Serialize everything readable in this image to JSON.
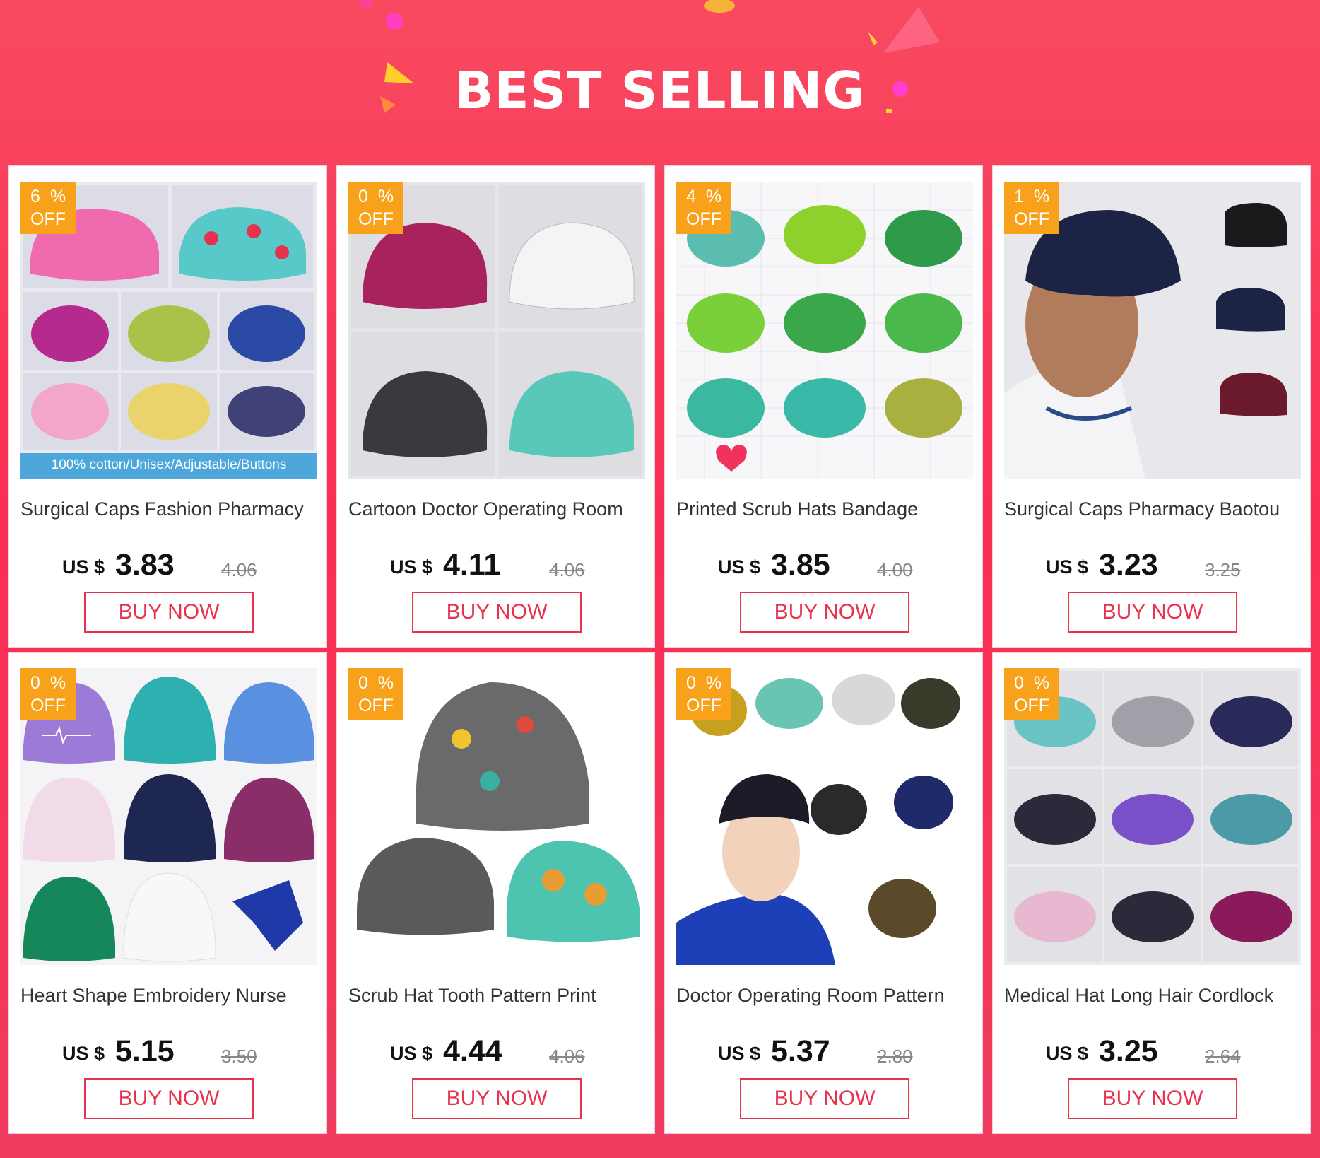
{
  "banner": {
    "title": "BEST SELLING"
  },
  "colors": {
    "background": "#fb2e55",
    "badge": "#f7a21a",
    "button": "#e8334f"
  },
  "products": [
    {
      "discount_digit": "6",
      "discount_symbol": "%",
      "off_label": "OFF",
      "title": "Surgical Caps Fashion Pharmacy",
      "currency": "US $",
      "price": "3.83",
      "original_price": "4.06",
      "button_label": "BUY NOW",
      "image_caption": "100% cotton/Unisex/Adjustable/Buttons"
    },
    {
      "discount_digit": "0",
      "discount_symbol": "%",
      "off_label": "OFF",
      "title": "Cartoon Doctor Operating Room",
      "currency": "US $",
      "price": "4.11",
      "original_price": "4.06",
      "button_label": "BUY NOW"
    },
    {
      "discount_digit": "4",
      "discount_symbol": "%",
      "off_label": "OFF",
      "title": "Printed Scrub Hats Bandage",
      "currency": "US $",
      "price": "3.85",
      "original_price": "4.00",
      "button_label": "BUY NOW"
    },
    {
      "discount_digit": "1",
      "discount_symbol": "%",
      "off_label": "OFF",
      "title": "Surgical Caps Pharmacy Baotou",
      "currency": "US $",
      "price": "3.23",
      "original_price": "3.25",
      "button_label": "BUY NOW"
    },
    {
      "discount_digit": "0",
      "discount_symbol": "%",
      "off_label": "OFF",
      "title": "Heart Shape Embroidery Nurse",
      "currency": "US $",
      "price": "5.15",
      "original_price": "3.50",
      "button_label": "BUY NOW"
    },
    {
      "discount_digit": "0",
      "discount_symbol": "%",
      "off_label": "OFF",
      "title": "Scrub Hat Tooth Pattern Print",
      "currency": "US $",
      "price": "4.44",
      "original_price": "4.06",
      "button_label": "BUY NOW"
    },
    {
      "discount_digit": "0",
      "discount_symbol": "%",
      "off_label": "OFF",
      "title": "Doctor Operating Room Pattern",
      "currency": "US $",
      "price": "5.37",
      "original_price": "2.80",
      "button_label": "BUY NOW"
    },
    {
      "discount_digit": "0",
      "discount_symbol": "%",
      "off_label": "OFF",
      "title": "Medical Hat Long Hair Cordlock",
      "currency": "US $",
      "price": "3.25",
      "original_price": "2.64",
      "button_label": "BUY NOW"
    }
  ]
}
